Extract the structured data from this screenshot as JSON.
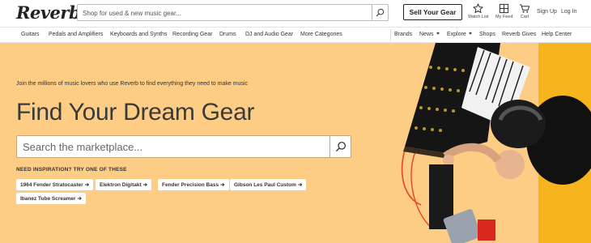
{
  "header": {
    "logo": "Reverb",
    "search_placeholder": "Shop for used & new music gear...",
    "sell_button": "Sell Your Gear",
    "icons": [
      {
        "label": "Watch List",
        "icon": "star-icon"
      },
      {
        "label": "My Feed",
        "icon": "grid-icon"
      },
      {
        "label": "Cart",
        "icon": "cart-icon"
      }
    ],
    "sign_up": "Sign Up",
    "log_in": "Log In"
  },
  "nav": {
    "categories": [
      "Guitars",
      "Pedals and Amplifiers",
      "Keyboards and Synths",
      "Recording Gear",
      "Drums",
      "DJ and Audio Gear",
      "More Categories"
    ],
    "right_links": [
      "Brands",
      "News",
      "Explore",
      "Shops",
      "Reverb Gives",
      "Help Center"
    ]
  },
  "hero": {
    "tagline": "Join the millions of music lovers who use Reverb to find everything they need to make music",
    "headline": "Find Your Dream Gear",
    "search_placeholder": "Search the marketplace...",
    "inspiration_label": "NEED INSPIRATION? TRY ONE OF THESE",
    "suggestions": [
      "1964 Fender Stratocaster",
      "Elektron Digitakt",
      "Fender Precision Bass",
      "Gibson Les Paul Custom",
      "Ibanez Tube Screamer"
    ],
    "background_color": "#fdcc85"
  }
}
